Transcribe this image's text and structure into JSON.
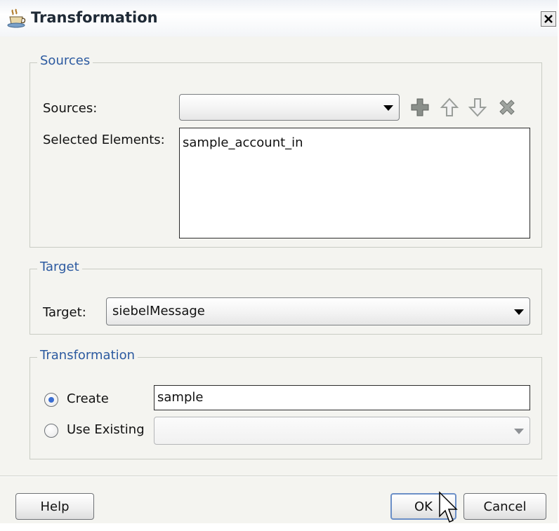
{
  "window": {
    "title": "Transformation",
    "title_icon": "coffee-cup-icon",
    "close_icon": "close-icon"
  },
  "sources_group": {
    "legend": "Sources",
    "sources_label": "Sources:",
    "sources_value": "",
    "selected_label": "Selected Elements:",
    "selected_items": [
      "sample_account_in"
    ],
    "toolbar_icons": [
      "add-icon",
      "move-up-icon",
      "move-down-icon",
      "remove-icon"
    ]
  },
  "target_group": {
    "legend": "Target",
    "target_label": "Target:",
    "target_value": "siebelMessage"
  },
  "transformation_group": {
    "legend": "Transformation",
    "create_label": "Create",
    "create_selected": true,
    "create_value": "sample",
    "use_existing_label": "Use Existing",
    "use_existing_selected": false,
    "use_existing_value": ""
  },
  "buttons": {
    "help": "Help",
    "ok": "OK",
    "cancel": "Cancel"
  },
  "colors": {
    "legend": "#2c5aa0",
    "radio_dot": "#3a6ed1",
    "default_button_border": "#6b8fc7",
    "add_icon": "#8a8f8a",
    "arrow_icons": "#b0b4b0",
    "remove_icon": "#9ea39e"
  }
}
